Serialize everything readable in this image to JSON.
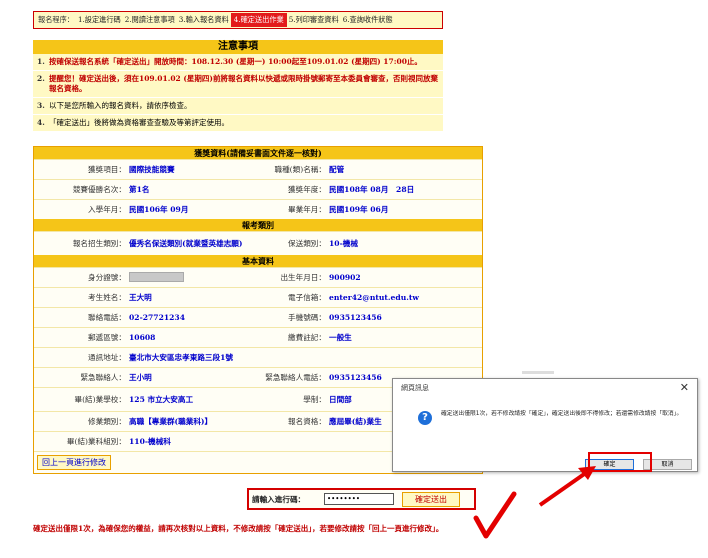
{
  "steps": {
    "label": "報名程序：",
    "items": [
      {
        "label": "1.設定進行碼",
        "active": false
      },
      {
        "label": "2.閱讀注意事項",
        "active": false
      },
      {
        "label": "3.輸入報名資料",
        "active": false
      },
      {
        "label": "4.確定送出作業",
        "active": true
      },
      {
        "label": "5.列印審查資料",
        "active": false
      },
      {
        "label": "6.查詢收件狀態",
        "active": false
      }
    ]
  },
  "notice": {
    "title": "注意事項",
    "items": [
      {
        "num": "1.",
        "text": "按確保送報名系統「確定送出」開放時間：108.12.30 (星期一) 10:00起至109.01.02 (星期四) 17:00止。"
      },
      {
        "num": "2.",
        "text": "提醒您！確定送出後，須在109.01.02 (星期四)前將報名資料以快遞或限時掛號郵寄至本委員會審查，否則視同放棄報名資格。"
      },
      {
        "num": "3.",
        "text": "以下是您所輸入的報名資料，請依序檢查。"
      },
      {
        "num": "4.",
        "text": "「確定送出」後將做為資格審查查驗及等第評定使用。"
      }
    ]
  },
  "sections": {
    "award": "獲獎資料(請備妥書面文件逐一核對)",
    "exam": "報考類別",
    "basic": "基本資料"
  },
  "award_rows": [
    {
      "l1": "獲獎項目：",
      "v1": "國際技能競賽",
      "l2": "職種(類)名稱：",
      "v2": "配管"
    },
    {
      "l1": "競賽優勝名次：",
      "v1": "第1名",
      "l2": "獲獎年度：",
      "v2": "民國108年 08月　28日"
    },
    {
      "l1": "入學年月：",
      "v1": "民國106年 09月",
      "l2": "畢業年月：",
      "v2": "民國109年 06月"
    }
  ],
  "exam_rows": [
    {
      "l1": "報名招生類別：",
      "v1": "優秀名保送類別(就業暨英雄志願)",
      "l2": "保送類別：",
      "v2": "10-機械"
    }
  ],
  "basic_rows": [
    {
      "l1": "身分證號：",
      "v1": "",
      "masked": true,
      "l2": "出生年月日：",
      "v2": "900902"
    },
    {
      "l1": "考生姓名：",
      "v1": "王大明",
      "l2": "電子信箱：",
      "v2": "enter42@ntut.edu.tw"
    },
    {
      "l1": "聯絡電話：",
      "v1": "02-27721234",
      "l2": "手機號碼：",
      "v2": "0935123456"
    },
    {
      "l1": "郵遞區號：",
      "v1": "10608",
      "l2": "繳費註記：",
      "v2": "一般生"
    },
    {
      "l1": "通訊地址：",
      "v1": "臺北市大安區忠孝東路三段1號",
      "l2": "",
      "v2": ""
    },
    {
      "l1": "緊急聯絡人：",
      "v1": "王小明",
      "l2": "緊急聯絡人電話：",
      "v2": "0935123456"
    },
    {
      "l1": "畢(結)業學校：",
      "v1": "125 市立大安高工",
      "l2": "學制：",
      "v2": "日間部"
    },
    {
      "l1": "修業類別：",
      "v1": "高職【專業群(職業科)】",
      "l2": "報名資格：",
      "v2": "應屆畢(結)業生"
    },
    {
      "l1": "畢(結)業科組別：",
      "v1": "110-機械科",
      "l2": "",
      "v2": ""
    }
  ],
  "footer": {
    "prev_button": "回上一頁進行修改",
    "pwd_label": "請輸入進行碼：",
    "pwd_value": "••••••••",
    "submit_button": "確定送出"
  },
  "bottom_note": "確定送出僅限1次，為確保您的權益，請再次核對以上資料，不修改請按「確定送出」，若要修改請按「回上一頁進行修改」。",
  "dialog": {
    "title": "網頁訊息",
    "close": "✕",
    "message": "確定送出僅限1次，若不修改請按「確定」，確定送出後即不得修改；若還需修改請按「取消」。",
    "ok": "確定",
    "cancel": "取消"
  },
  "colors": {
    "accent": "#f5c518",
    "highlight": "#e30000"
  }
}
